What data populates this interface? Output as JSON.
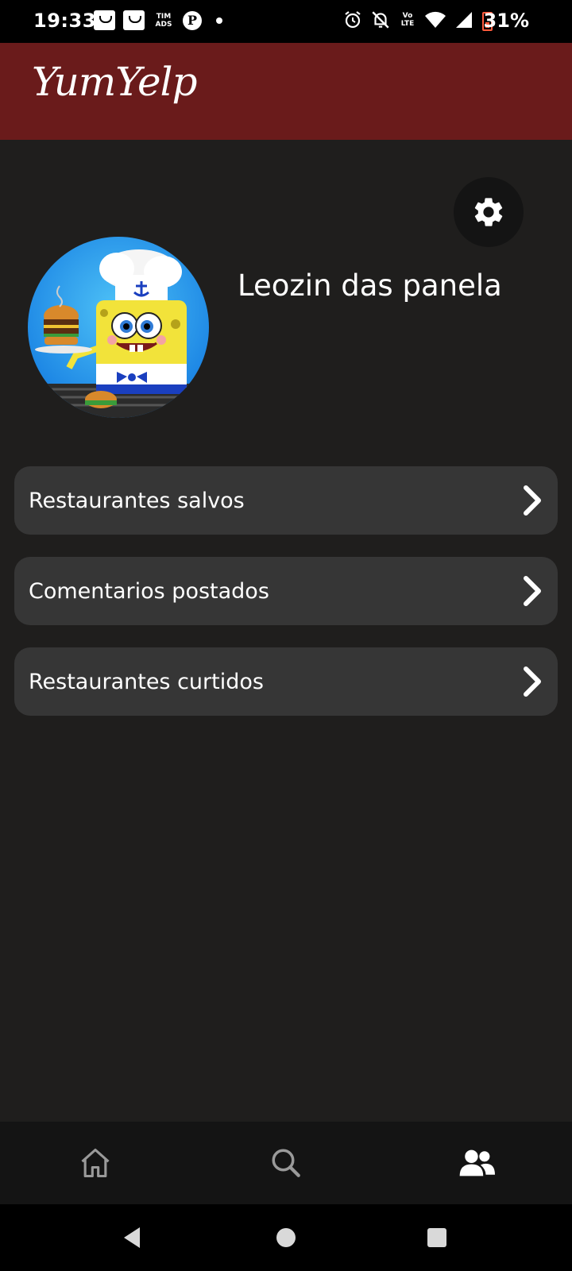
{
  "status_bar": {
    "time": "19:33",
    "carrier_badge": "TIM ADS",
    "volte_badge": "Vo LTE",
    "battery_pct": "31%",
    "icons": [
      "shopping-bag-icon",
      "shopping-bag-icon",
      "tim-ads-icon",
      "pinterest-icon",
      "notification-dot-icon",
      "alarm-icon",
      "mute-bell-icon",
      "volte-icon",
      "wifi-icon",
      "signal-icon",
      "battery-icon"
    ]
  },
  "app_bar": {
    "logo": "YumYelp",
    "background": "#6a1b1b"
  },
  "profile": {
    "name": "Leozin das panela",
    "avatar_icon": "chef-sponge-avatar",
    "settings_icon": "gear-icon"
  },
  "menu": {
    "items": [
      {
        "label": "Restaurantes salvos",
        "icon": "chevron-right-icon"
      },
      {
        "label": "Comentarios postados",
        "icon": "chevron-right-icon"
      },
      {
        "label": "Restaurantes curtidos",
        "icon": "chevron-right-icon"
      }
    ]
  },
  "bottom_nav": {
    "items": [
      {
        "name": "home",
        "icon": "home-icon",
        "active": false
      },
      {
        "name": "search",
        "icon": "search-icon",
        "active": false
      },
      {
        "name": "profile",
        "icon": "users-icon",
        "active": true
      }
    ]
  },
  "system_nav": {
    "icons": [
      "back-icon",
      "home-circle-icon",
      "recents-icon"
    ]
  },
  "colors": {
    "background": "#1f1e1d",
    "card": "#363636",
    "accent": "#6a1b1b",
    "nav_inactive": "#9a9a9a",
    "nav_active": "#ffffff"
  }
}
